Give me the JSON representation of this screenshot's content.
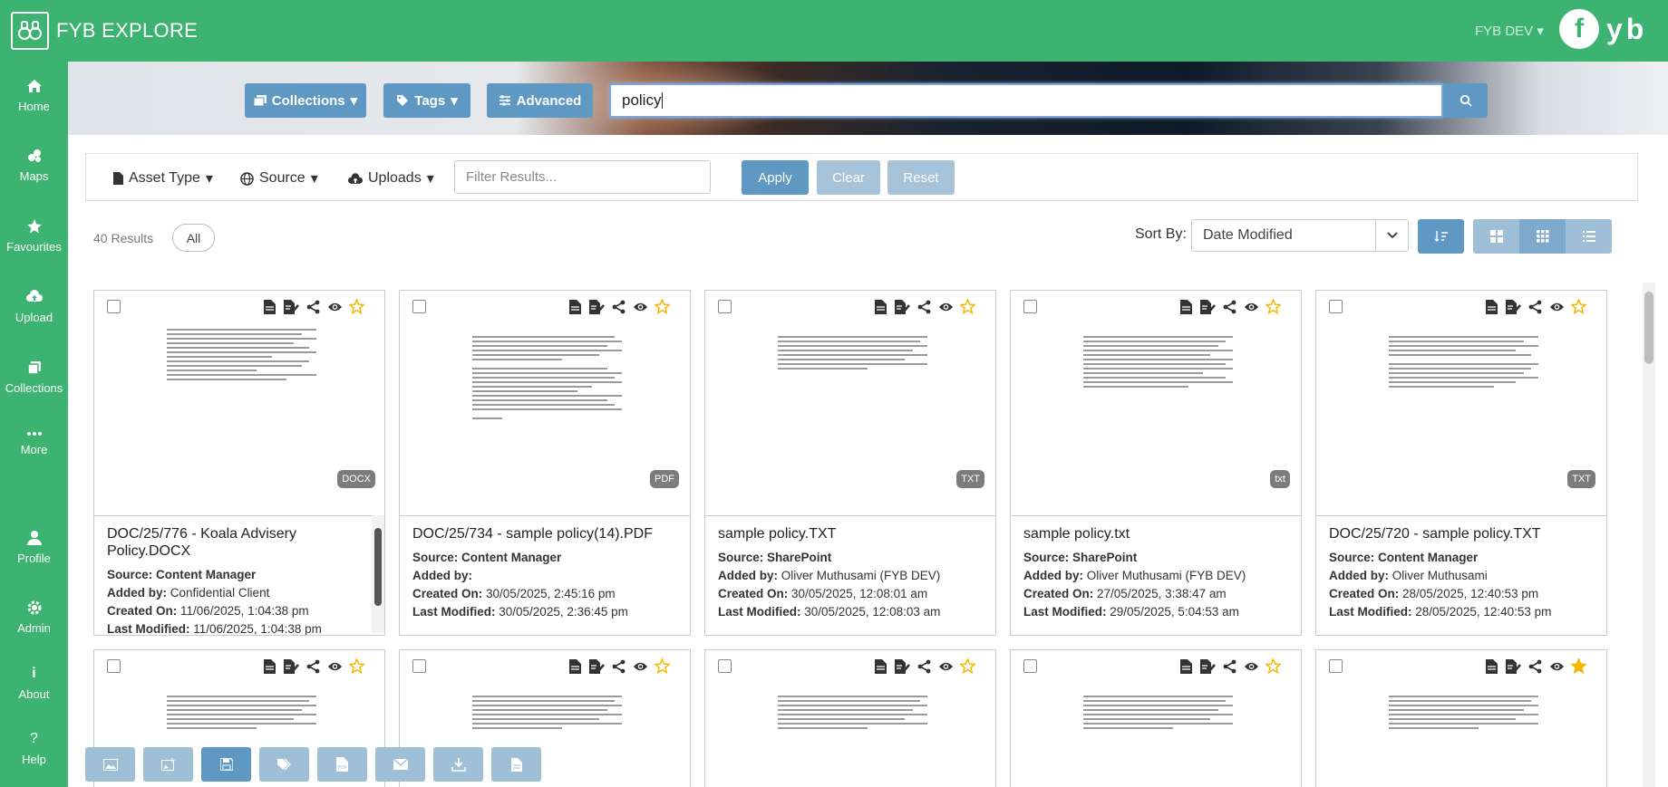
{
  "app": {
    "title": "FYB EXPLORE",
    "tenant": "FYB DEV",
    "brand_letter": "f",
    "brand_rest": "yb"
  },
  "sidebar": {
    "items": [
      {
        "label": "Home",
        "icon": "home-icon"
      },
      {
        "label": "Maps",
        "icon": "map-icon"
      },
      {
        "label": "Favourites",
        "icon": "star-icon"
      },
      {
        "label": "Upload",
        "icon": "cloud-upload-icon"
      },
      {
        "label": "Collections",
        "icon": "collections-icon"
      },
      {
        "label": "More",
        "icon": "ellipsis-icon"
      },
      {
        "label": "Profile",
        "icon": "user-icon"
      },
      {
        "label": "Admin",
        "icon": "gear-icon"
      },
      {
        "label": "About",
        "icon": "info-icon"
      },
      {
        "label": "Help",
        "icon": "question-icon"
      }
    ]
  },
  "search": {
    "collections_label": "Collections",
    "tags_label": "Tags",
    "advanced_label": "Advanced",
    "query": "policy"
  },
  "filters": {
    "asset_type": "Asset Type",
    "source": "Source",
    "uploads": "Uploads",
    "placeholder": "Filter Results...",
    "apply": "Apply",
    "clear": "Clear",
    "reset": "Reset"
  },
  "results": {
    "count": "40 Results",
    "all": "All",
    "sort_by_label": "Sort By:",
    "sort_value": "Date Modified"
  },
  "labels": {
    "source": "Source:",
    "added_by": "Added by:",
    "created_on": "Created On:",
    "last_modified": "Last Modified:"
  },
  "cards": [
    {
      "title": "DOC/25/776 - Koala Advisery Policy.DOCX",
      "badge": "DOCX",
      "source": "Content Manager",
      "added_by": "Confidential Client",
      "created_on": "11/06/2025, 1:04:38 pm",
      "last_modified": "11/06/2025, 1:04:38 pm",
      "favourite": false
    },
    {
      "title": "DOC/25/734 - sample policy(14).PDF",
      "badge": "PDF",
      "source": "Content Manager",
      "added_by": "",
      "created_on": "30/05/2025, 2:45:16 pm",
      "last_modified": "30/05/2025, 2:36:45 pm",
      "favourite": false
    },
    {
      "title": "sample policy.TXT",
      "badge": "TXT",
      "source": "SharePoint",
      "added_by": "Oliver Muthusami (FYB DEV)",
      "created_on": "30/05/2025, 12:08:01 am",
      "last_modified": "30/05/2025, 12:08:03 am",
      "favourite": false
    },
    {
      "title": "sample policy.txt",
      "badge": "txt",
      "source": "SharePoint",
      "added_by": "Oliver Muthusami (FYB DEV)",
      "created_on": "27/05/2025, 3:38:47 am",
      "last_modified": "29/05/2025, 5:04:53 am",
      "favourite": false
    },
    {
      "title": "DOC/25/720 - sample policy.TXT",
      "badge": "TXT",
      "source": "Content Manager",
      "added_by": "Oliver Muthusami",
      "created_on": "28/05/2025, 12:40:53 pm",
      "last_modified": "28/05/2025, 12:40:53 pm",
      "favourite": false
    }
  ],
  "second_row_favourites": [
    false,
    false,
    false,
    false,
    true
  ],
  "bottom_toolbar": [
    {
      "icon": "image-icon"
    },
    {
      "icon": "add-image-icon"
    },
    {
      "icon": "save-icon"
    },
    {
      "icon": "tags-icon"
    },
    {
      "icon": "pdf-icon"
    },
    {
      "icon": "email-icon"
    },
    {
      "icon": "download-icon"
    },
    {
      "icon": "document-icon"
    }
  ],
  "colors": {
    "brand_green": "#3cb371",
    "button_blue": "#5f98c2",
    "star_gold": "#f5b800"
  }
}
